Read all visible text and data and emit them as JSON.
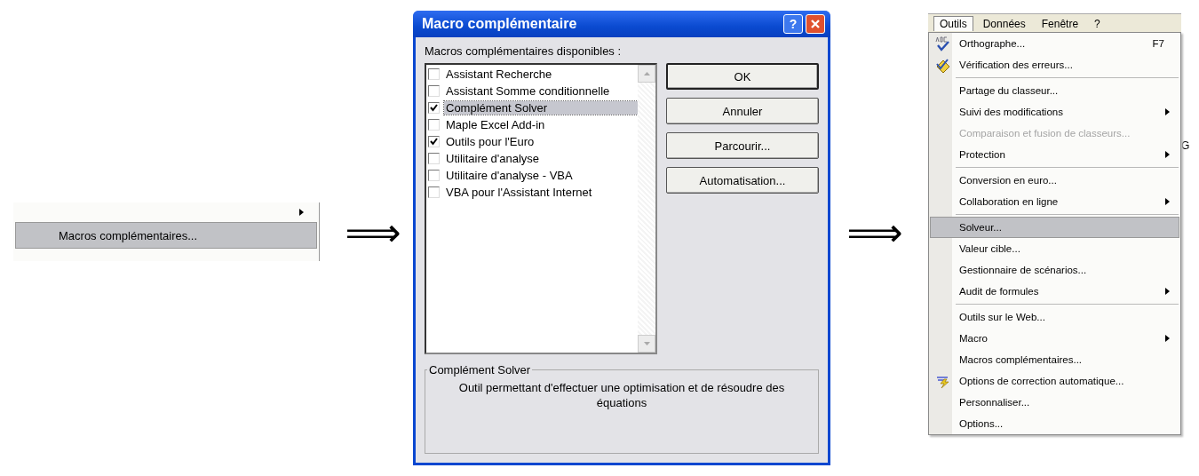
{
  "left_menu": {
    "items": [
      {
        "submenu": true,
        "selected": false
      },
      {
        "label": "Macros complémentaires...",
        "submenu": false,
        "selected": true
      }
    ]
  },
  "arrows": [
    "⟹",
    "⟹"
  ],
  "dialog": {
    "title": "Macro complémentaire",
    "help": "?",
    "list_label": "Macros complémentaires disponibles :",
    "addins": [
      {
        "label": "Assistant Recherche",
        "checked": false,
        "selected": false
      },
      {
        "label": "Assistant Somme conditionnelle",
        "checked": false,
        "selected": false
      },
      {
        "label": "Complément Solver",
        "checked": true,
        "selected": true
      },
      {
        "label": "Maple Excel Add-in",
        "checked": false,
        "selected": false
      },
      {
        "label": "Outils pour l'Euro",
        "checked": true,
        "selected": false
      },
      {
        "label": "Utilitaire d'analyse",
        "checked": false,
        "selected": false
      },
      {
        "label": "Utilitaire d'analyse - VBA",
        "checked": false,
        "selected": false
      },
      {
        "label": "VBA pour l'Assistant Internet",
        "checked": false,
        "selected": false
      }
    ],
    "buttons": [
      {
        "label": "OK",
        "default": true
      },
      {
        "label": "Annuler",
        "default": false
      },
      {
        "label": "Parcourir...",
        "default": false
      },
      {
        "label": "Automatisation...",
        "default": false
      }
    ],
    "group_title": "Complément Solver",
    "description": "Outil permettant d'effectuer une optimisation et de résoudre des équations"
  },
  "tools_menu": {
    "menubar": [
      {
        "label": "Outils",
        "selected": true
      },
      {
        "label": "Données",
        "selected": false
      },
      {
        "label": "Fenêtre",
        "selected": false
      },
      {
        "label": "?",
        "selected": false
      }
    ],
    "column_header": "G",
    "groups": [
      [
        {
          "label": "Orthographe...",
          "shortcut": "F7",
          "kind": "spelling",
          "submenu": false,
          "disabled": false,
          "selected": false
        },
        {
          "label": "Vérification des erreurs...",
          "kind": "errorcheck",
          "submenu": false,
          "disabled": false,
          "selected": false
        }
      ],
      [
        {
          "label": "Partage du classeur...",
          "kind": "plain",
          "submenu": false,
          "disabled": false,
          "selected": false
        },
        {
          "label": "Suivi des modifications",
          "kind": "plain",
          "submenu": true,
          "disabled": false,
          "selected": false
        },
        {
          "label": "Comparaison et fusion de classeurs...",
          "kind": "plain",
          "submenu": false,
          "disabled": true,
          "selected": false
        },
        {
          "label": "Protection",
          "kind": "plain",
          "submenu": true,
          "disabled": false,
          "selected": false
        }
      ],
      [
        {
          "label": "Conversion en euro...",
          "kind": "plain",
          "submenu": false,
          "disabled": false,
          "selected": false
        },
        {
          "label": "Collaboration en ligne",
          "kind": "plain",
          "submenu": true,
          "disabled": false,
          "selected": false
        }
      ],
      [
        {
          "label": "Solveur...",
          "kind": "plain",
          "submenu": false,
          "disabled": false,
          "selected": true
        },
        {
          "label": "Valeur cible...",
          "kind": "plain",
          "submenu": false,
          "disabled": false,
          "selected": false
        },
        {
          "label": "Gestionnaire de scénarios...",
          "kind": "plain",
          "submenu": false,
          "disabled": false,
          "selected": false
        },
        {
          "label": "Audit de formules",
          "kind": "plain",
          "submenu": true,
          "disabled": false,
          "selected": false
        }
      ],
      [
        {
          "label": "Outils sur le Web...",
          "kind": "plain",
          "submenu": false,
          "disabled": false,
          "selected": false
        },
        {
          "label": "Macro",
          "kind": "plain",
          "submenu": true,
          "disabled": false,
          "selected": false
        },
        {
          "label": "Macros complémentaires...",
          "kind": "plain",
          "submenu": false,
          "disabled": false,
          "selected": false
        },
        {
          "label": "Options de correction automatique...",
          "kind": "autocorrect",
          "submenu": false,
          "disabled": false,
          "selected": false
        },
        {
          "label": "Personnaliser...",
          "kind": "plain",
          "submenu": false,
          "disabled": false,
          "selected": false
        },
        {
          "label": "Options...",
          "kind": "plain",
          "submenu": false,
          "disabled": false,
          "selected": false
        }
      ]
    ]
  }
}
